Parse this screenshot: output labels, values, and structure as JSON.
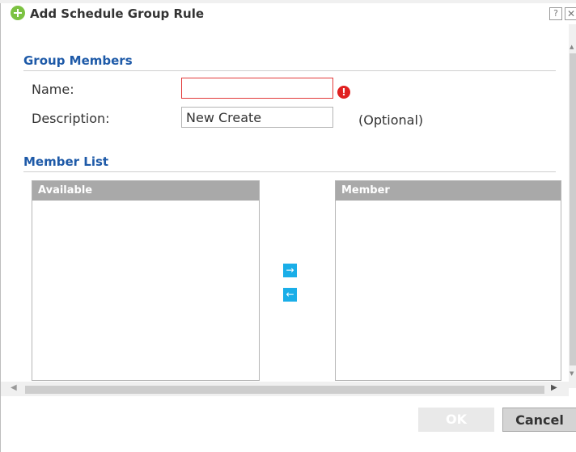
{
  "dialog": {
    "title": "Add Schedule Group Rule",
    "help_glyph": "?",
    "close_glyph": "✕"
  },
  "group_members": {
    "heading": "Group Members",
    "name_label": "Name:",
    "name_value": "",
    "description_label": "Description:",
    "description_value": "New Create",
    "optional_note": "(Optional)"
  },
  "member_list": {
    "heading": "Member List",
    "available_header": "Available",
    "member_header": "Member",
    "available_items": [],
    "member_items": []
  },
  "transfer": {
    "add_glyph": "→",
    "remove_glyph": "←"
  },
  "footer": {
    "ok_label": "OK",
    "cancel_label": "Cancel"
  },
  "colors": {
    "section_heading": "#1e5aa8",
    "error": "#e02020",
    "transfer_button": "#1aaee8",
    "list_header": "#a9a9a9",
    "title_icon": "#7cc242"
  }
}
